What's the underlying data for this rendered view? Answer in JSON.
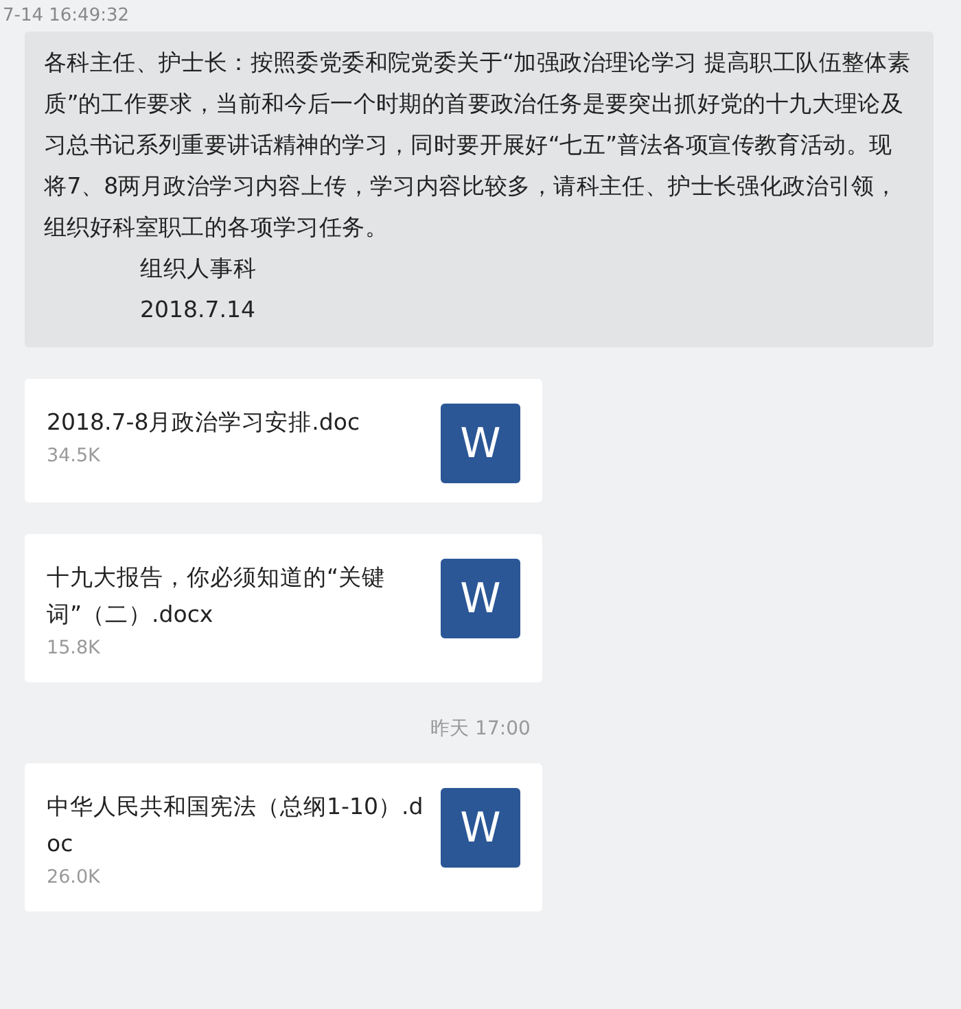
{
  "messages": [
    {
      "kind": "text",
      "time": "7-14 16:49:32",
      "body": "各科主任、护士长：按照委党委和院党委关于“加强政治理论学习 提高职工队伍整体素质”的工作要求，当前和今后一个时期的首要政治任务是要突出抓好党的十九大理论及习总书记系列重要讲话精神的学习，同时要开展好“七五”普法各项宣传教育活动。现将7、8两月政治学习内容上传，学习内容比较多，请科主任、护士长强化政治引领，组织好科室职工的各项学习任务。",
      "signature": [
        "组织人事科",
        "2018.7.14"
      ]
    },
    {
      "kind": "file",
      "name": "2018.7-8月政治学习安排.doc",
      "size": "34.5K",
      "icon": "W"
    },
    {
      "kind": "file",
      "name": "十九大报告，你必须知道的“关键词”（二）.docx",
      "size": "15.8K",
      "icon": "W"
    },
    {
      "kind": "time",
      "time": "昨天 17:00"
    },
    {
      "kind": "file",
      "name": "中华人民共和国宪法（总纲1-10）.doc",
      "size": "26.0K",
      "icon": "W"
    }
  ]
}
